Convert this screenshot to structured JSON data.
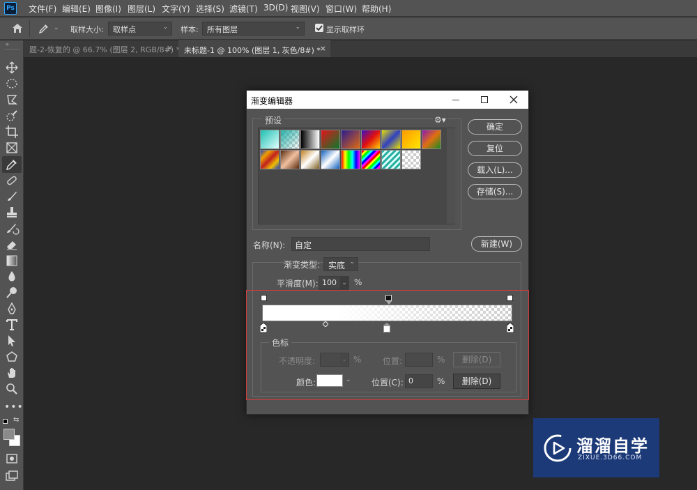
{
  "app": {
    "logo": "Ps"
  },
  "menu": [
    "文件(F)",
    "编辑(E)",
    "图像(I)",
    "图层(L)",
    "文字(Y)",
    "选择(S)",
    "滤镜(T)",
    "3D(D)",
    "视图(V)",
    "窗口(W)",
    "帮助(H)"
  ],
  "options": {
    "sample_size_label": "取样大小:",
    "sample_size_value": "取样点",
    "sample_label": "样本:",
    "sample_value": "所有图层",
    "show_ring_label": "显示取样环"
  },
  "tabs": [
    {
      "label": "题-2-恢复的 @ 66.7% (图层 2, RGB/8#) *",
      "active": false
    },
    {
      "label": "未标题-1 @ 100% (图层 1, 灰色/8#) *",
      "active": true
    }
  ],
  "tools": [
    "move-icon",
    "marquee-icon",
    "lasso-icon",
    "quick-select-icon",
    "crop-icon",
    "frame-icon",
    "eyedropper-icon",
    "healing-icon",
    "brush-icon",
    "stamp-icon",
    "history-brush-icon",
    "eraser-icon",
    "gradient-icon",
    "blur-icon",
    "dodge-icon",
    "pen-icon",
    "type-icon",
    "path-select-icon",
    "shape-icon",
    "hand-icon",
    "zoom-icon",
    "more-icon"
  ],
  "dialog": {
    "title": "渐变编辑器",
    "presets_label": "预设",
    "ok": "确定",
    "reset": "复位",
    "load": "载入(L)...",
    "save": "存储(S)...",
    "name_label": "名称(N):",
    "name_value": "自定",
    "new_button": "新建(W)",
    "type_label": "渐变类型:",
    "type_value": "实底",
    "smooth_label": "平滑度(M):",
    "smooth_value": "100",
    "smooth_unit": "%",
    "stops_label": "色标",
    "opacity_label": "不透明度:",
    "opacity_unit": "%",
    "opacity_pos_label": "位置:",
    "opacity_pos_unit": "%",
    "opacity_delete": "删除(D)",
    "color_label": "颜色:",
    "color_value": "#ffffff",
    "color_pos_label": "位置(C):",
    "color_pos_value": "0",
    "color_pos_unit": "%",
    "color_delete": "删除(D)"
  },
  "preset_gradients": [
    "linear-gradient(135deg,#1fbfb0,#e0ffff)",
    "checker-teal",
    "linear-gradient(90deg,#000,#fff)",
    "linear-gradient(135deg,#e0151b,#0b7a2a)",
    "linear-gradient(135deg,#2a1b8f,#e06a10)",
    "linear-gradient(135deg,#3a10c0,#e01010,#ffd000)",
    "linear-gradient(135deg,#e8e000,#3040c0,#e8e000)",
    "linear-gradient(135deg,#ff9a00,#ffe600)",
    "linear-gradient(135deg,#8a1ab0,#e07010,#1a8a20)",
    "linear-gradient(135deg,#2040c0,#f0a000,#c02020,#f0c000,#2040c0)",
    "linear-gradient(135deg,#5a2a10,#f0c0a0,#5a2a10)",
    "linear-gradient(135deg,#c08020,#fff,#806020)",
    "linear-gradient(135deg,#1060c0,#fff,#1060c0)",
    "linear-gradient(90deg,#ff0000,#ffff00,#00ff00,#00ffff,#0000ff,#ff00ff)",
    "repeating-linear-gradient(135deg,#f00 0 3px,#ff0 3px 6px,#0f0 6px 9px,#0ff 9px 12px,#00f 12px 15px,#f0f 15px 18px)",
    "repeating-linear-gradient(135deg,#2ab0a0 0 3px,#e0ffff 3px 6px)",
    "checker"
  ],
  "watermark": {
    "title": "溜溜自学",
    "url": "ZIXUE.3D66.COM"
  }
}
